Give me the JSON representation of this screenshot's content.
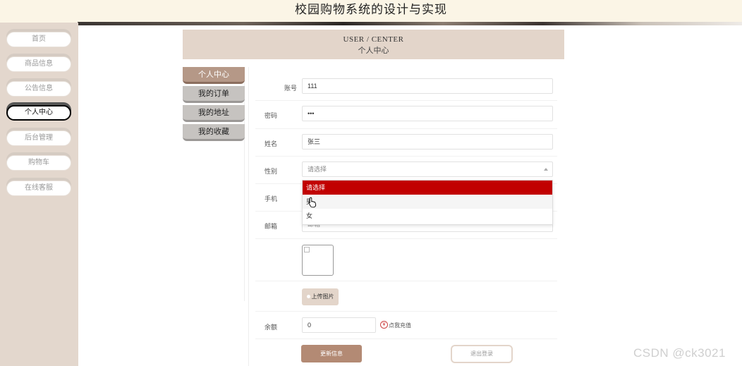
{
  "site": {
    "title": "校园购物系统的设计与实现"
  },
  "nav": {
    "items": [
      {
        "label": "首页"
      },
      {
        "label": "商品信息"
      },
      {
        "label": "公告信息"
      },
      {
        "label": "个人中心"
      },
      {
        "label": "后台管理"
      },
      {
        "label": "购物车"
      },
      {
        "label": "在线客服"
      }
    ],
    "active": "个人中心"
  },
  "center": {
    "title_en": "USER / CENTER",
    "title_cn": "个人中心"
  },
  "subnav": {
    "items": [
      {
        "label": "个人中心"
      },
      {
        "label": "我的订单"
      },
      {
        "label": "我的地址"
      },
      {
        "label": "我的收藏"
      }
    ],
    "active": "个人中心"
  },
  "form": {
    "account": {
      "label": "账号",
      "value": "111"
    },
    "password": {
      "label": "密码",
      "value": "•••"
    },
    "name": {
      "label": "姓名",
      "value": "张三"
    },
    "gender": {
      "label": "性别",
      "value": "请选择",
      "options": [
        "请选择",
        "男",
        "女"
      ],
      "highlighted": "请选择",
      "hovered": "男"
    },
    "phone": {
      "label": "手机"
    },
    "email": {
      "label": "邮箱",
      "value": "邮箱"
    },
    "upload_label": "上传图片",
    "balance": {
      "label": "余额",
      "value": "0",
      "recharge_icon": "¥",
      "recharge_label": "点我充值"
    },
    "update_label": "更新信息",
    "logout_label": "退出登录"
  },
  "watermark": "CSDN @ck3021",
  "colors": {
    "accent": "#b38a74",
    "header_bg": "#e3d5ca",
    "selected_option": "#c10000",
    "topbar_bg": "#fbf5e6"
  }
}
